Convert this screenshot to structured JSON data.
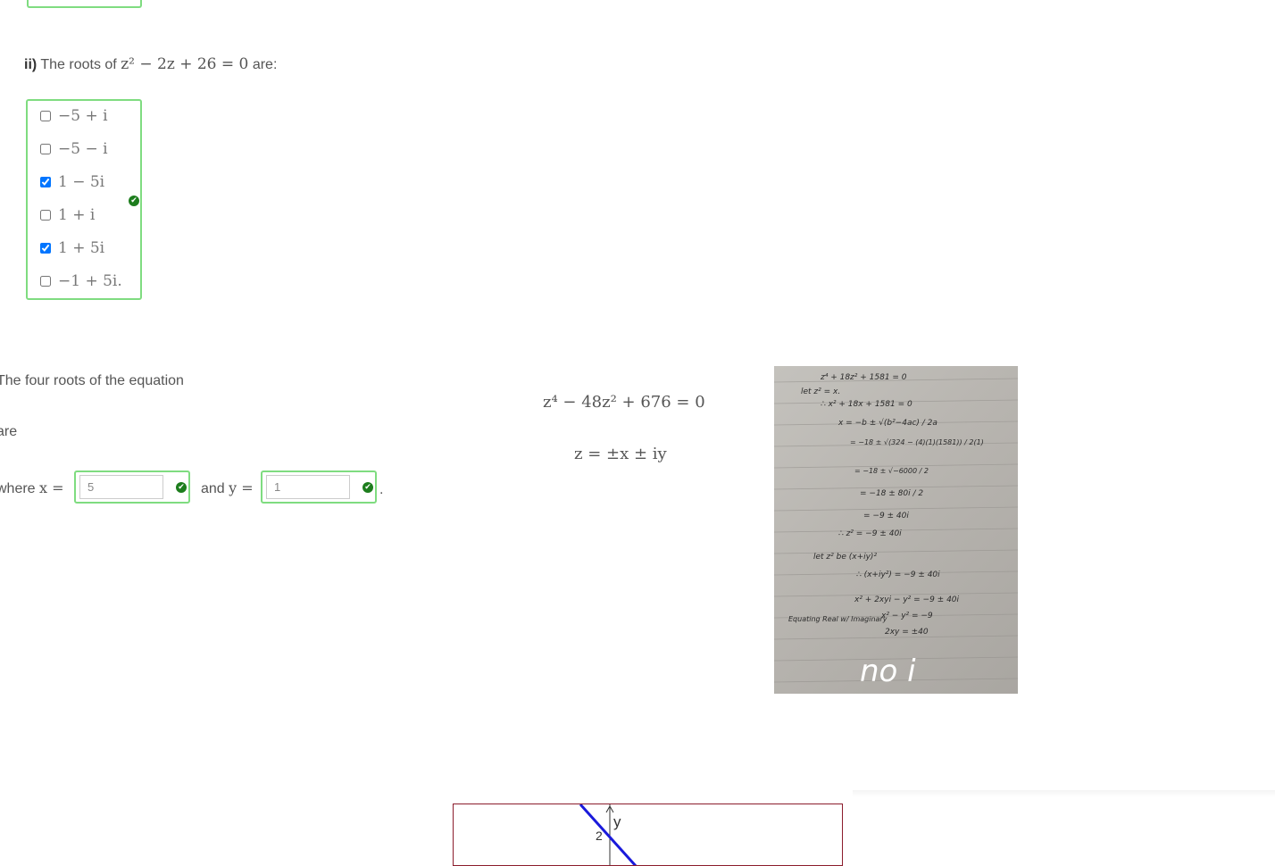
{
  "question_ii": {
    "number": "ii)",
    "text_before": "The roots of",
    "text_after": "are:",
    "equation": "z² − 2z + 26 = 0",
    "choices": [
      {
        "label": "−5 + i",
        "checked": false
      },
      {
        "label": "−5 − i",
        "checked": false
      },
      {
        "label": "1 − 5i",
        "checked": true
      },
      {
        "label": "1 + i",
        "checked": false
      },
      {
        "label": "1 + 5i",
        "checked": true
      },
      {
        "label": "−1 + 5i.",
        "checked": false
      }
    ],
    "status": "correct"
  },
  "question_iii": {
    "intro": "The four roots of the equation",
    "are": "are",
    "equation": "z⁴ − 48z² + 676 = 0",
    "form": "z = ±x ± iy",
    "where_label": "where",
    "x_label": "x =",
    "and_label": "and",
    "y_label": "y =",
    "x_value": "5",
    "y_value": "1",
    "trailing": "."
  },
  "handwritten_note": {
    "lines": [
      "z⁴ + 18z² + 1581 = 0",
      "let z² = x.",
      "∴ x² + 18x + 1581 = 0",
      "x = −b ± √(b²−4ac) / 2a",
      "= −18 ± √(324 − (4)(1)(1581)) / 2(1)",
      "= −18 ± √−6000 / 2",
      "= −18 ± 80i / 2",
      "= −9 ± 40i",
      "∴ z² = −9 ± 40i",
      "let z² be (x+iy)²",
      "∴ (x+iy²) = −9 ± 40i",
      "x² + 2xyi − y² = −9 ± 40i",
      "Equating Real w/ Imaginary",
      "x² − y² = −9",
      "2xy = ±40",
      "no i"
    ]
  },
  "graph": {
    "axis_label_y": "y",
    "tick_label": "2"
  },
  "colors": {
    "correct_border": "#7fdc80",
    "correct_icon": "#1d7d1d",
    "graph_border": "#8b1c2c",
    "graph_line": "#1a1adb"
  }
}
